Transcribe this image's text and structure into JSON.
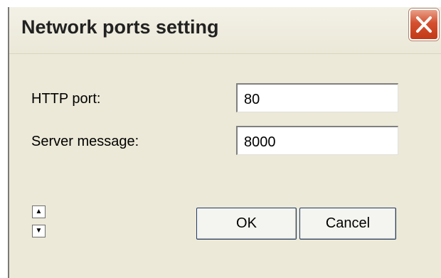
{
  "dialog": {
    "title": "Network ports setting",
    "close_icon": "close-icon"
  },
  "fields": [
    {
      "label": "HTTP port:",
      "value": "80"
    },
    {
      "label": "Server message:",
      "value": "8000"
    }
  ],
  "spinner": {
    "up_icon": "arrow-up-icon",
    "down_icon": "arrow-down-icon",
    "up_glyph": "▲",
    "down_glyph": "▼"
  },
  "buttons": {
    "ok_label": "OK",
    "cancel_label": "Cancel"
  },
  "colors": {
    "dialog_bg": "#ece9d8",
    "close_button": "#d4502e"
  }
}
